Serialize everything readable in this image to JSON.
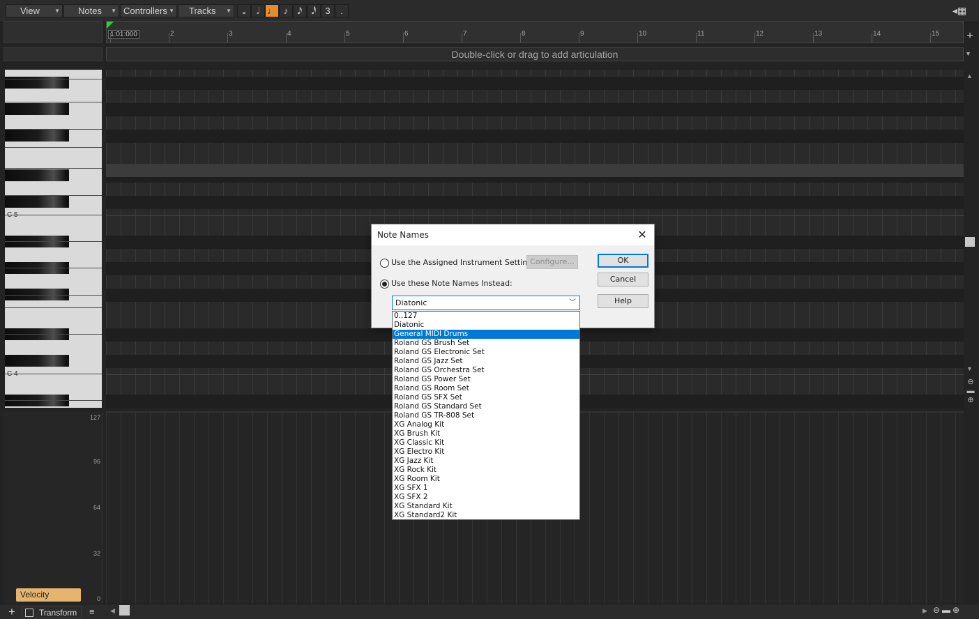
{
  "toolbar": {
    "menus": [
      {
        "label": "View"
      },
      {
        "label": "Notes"
      },
      {
        "label": "Controllers"
      },
      {
        "label": "Tracks"
      }
    ],
    "durations": [
      {
        "glyph": "𝅝",
        "active": false
      },
      {
        "glyph": "𝅗𝅥",
        "active": false
      },
      {
        "glyph": "♩",
        "active": true
      },
      {
        "glyph": "♪",
        "active": false
      },
      {
        "glyph": "𝅘𝅥𝅯",
        "active": false
      },
      {
        "glyph": "𝅘𝅥𝅰",
        "active": false
      },
      {
        "glyph": "3",
        "active": false
      },
      {
        "glyph": ".",
        "active": false
      }
    ]
  },
  "timeline": {
    "now_time": "1:01:000",
    "bars": [
      "2",
      "3",
      "4",
      "5",
      "6",
      "7",
      "8",
      "9",
      "10",
      "11",
      "12",
      "13",
      "14",
      "15"
    ]
  },
  "articulation": {
    "hint": "Double-click or drag to add articulation"
  },
  "piano": {
    "labels": [
      {
        "text": "C 5"
      },
      {
        "text": "C 4"
      }
    ]
  },
  "controller": {
    "velocity_ticks": [
      "127",
      "96",
      "64",
      "32",
      "0"
    ],
    "velocity_button": "Velocity"
  },
  "bottom": {
    "transform_label": "Transform"
  },
  "dialog": {
    "title": "Note Names",
    "option_assigned": "Use the Assigned Instrument Settings",
    "option_names": "Use these Note Names Instead:",
    "configure_label": "Configure...",
    "ok_label": "OK",
    "cancel_label": "Cancel",
    "help_label": "Help",
    "selected_value": "Diatonic",
    "options": [
      "0..127",
      "Diatonic",
      "General MIDI Drums",
      "Roland GS Brush Set",
      "Roland GS Electronic Set",
      "Roland GS Jazz Set",
      "Roland GS Orchestra Set",
      "Roland GS Power Set",
      "Roland GS Room Set",
      "Roland GS SFX Set",
      "Roland GS Standard Set",
      "Roland GS TR-808 Set",
      "XG Analog Kit",
      "XG Brush Kit",
      "XG Classic Kit",
      "XG Electro Kit",
      "XG Jazz Kit",
      "XG Rock Kit",
      "XG Room Kit",
      "XG SFX 1",
      "XG SFX 2",
      "XG Standard Kit",
      "XG Standard2 Kit"
    ],
    "highlighted_option": "General MIDI Drums"
  },
  "colors": {
    "accent": "#e38d2c",
    "velocity": "#e5b56f",
    "selection": "#0078d7",
    "cursor": "#2ed12e"
  }
}
